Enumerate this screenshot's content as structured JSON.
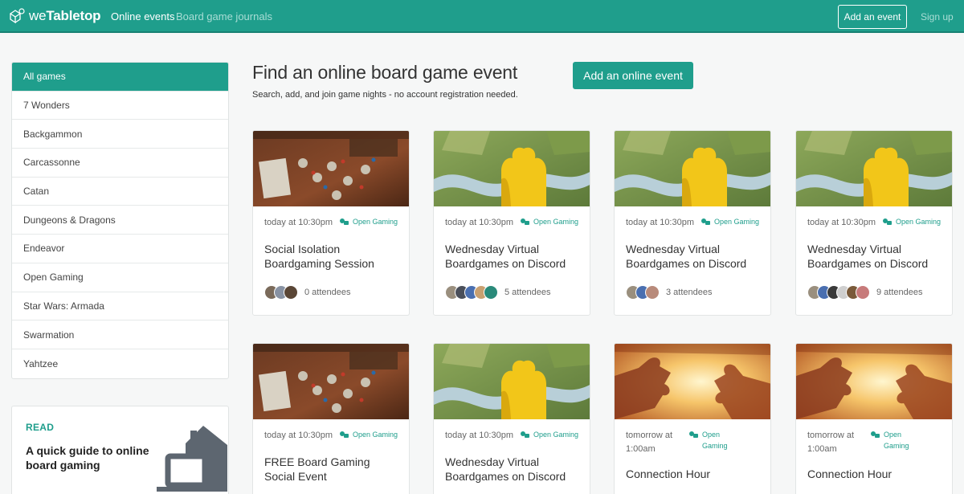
{
  "header": {
    "brand_prefix": "we",
    "brand_bold": "Tabletop",
    "nav": [
      "Online events",
      "Board game journals"
    ],
    "add_event": "Add an event",
    "sign_up": "Sign up"
  },
  "sidebar": {
    "games": [
      "All games",
      "7 Wonders",
      "Backgammon",
      "Carcassonne",
      "Catan",
      "Dungeons & Dragons",
      "Endeavor",
      "Open Gaming",
      "Star Wars: Armada",
      "Swarmation",
      "Yahtzee"
    ],
    "guide": {
      "kicker": "READ",
      "title": "A quick guide to online board gaming"
    }
  },
  "main": {
    "title": "Find an online board game event",
    "subtitle": "Search, add, and join game nights - no account registration needed.",
    "add_button": "Add an online event"
  },
  "events": [
    {
      "time": "today at 10:30pm",
      "category": "Open Gaming",
      "title": "Social Isolation Boardgaming Session",
      "attendees": "0 attendees",
      "image": "tabletop",
      "avatars": [
        "#7a6a5a",
        "#8892a3",
        "#5a4636"
      ]
    },
    {
      "time": "today at 10:30pm",
      "category": "Open Gaming",
      "title": "Wednesday Virtual Boardgames on Discord",
      "attendees": "5 attendees",
      "image": "meeple",
      "avatars": [
        "#9a8f7e",
        "#4a4f5a",
        "#4a6fb0",
        "#c9a070",
        "#2a8a7a"
      ]
    },
    {
      "time": "today at 10:30pm",
      "category": "Open Gaming",
      "title": "Wednesday Virtual Boardgames on Discord",
      "attendees": "3 attendees",
      "image": "meeple",
      "avatars": [
        "#9a8f7e",
        "#4a6fb0",
        "#b88a7a"
      ]
    },
    {
      "time": "today at 10:30pm",
      "category": "Open Gaming",
      "title": "Wednesday Virtual Boardgames on Discord",
      "attendees": "9 attendees",
      "image": "meeple",
      "avatars": [
        "#9a8f7e",
        "#4a6fb0",
        "#3a3a3a",
        "#cfcfcf",
        "#7a5a3a",
        "#c77a7a"
      ]
    },
    {
      "time": "today at 10:30pm",
      "category": "Open Gaming",
      "title": "FREE Board Gaming Social Event",
      "image": "tabletop"
    },
    {
      "time": "today at 10:30pm",
      "category": "Open Gaming",
      "title": "Wednesday Virtual Boardgames on Discord",
      "image": "meeple"
    },
    {
      "time": "tomorrow at 1:00am",
      "category": "Open Gaming",
      "title": "Connection Hour",
      "image": "puzzle"
    },
    {
      "time": "tomorrow at 1:00am",
      "category": "Open Gaming",
      "title": "Connection Hour",
      "image": "puzzle"
    }
  ]
}
